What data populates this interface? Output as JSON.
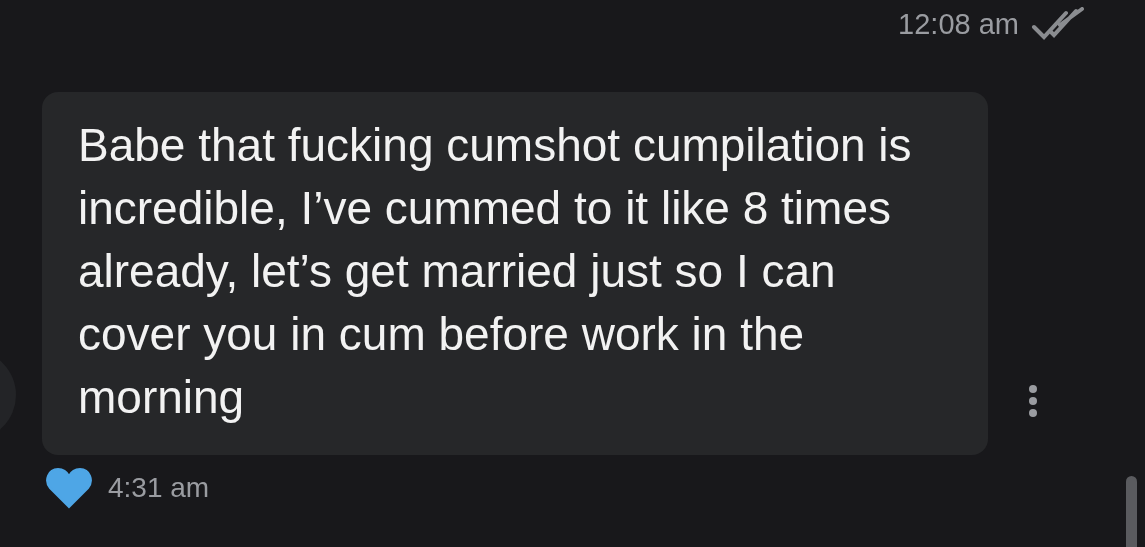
{
  "previous_message": {
    "time": "12:08 am",
    "read": true
  },
  "message": {
    "text": "Babe that fucking cumshot cumpilation is incredible, I’ve cummed to it like 8 times already, let’s get married just so I can cover you in cum before work in the morning",
    "liked": true,
    "time": "4:31 am"
  }
}
